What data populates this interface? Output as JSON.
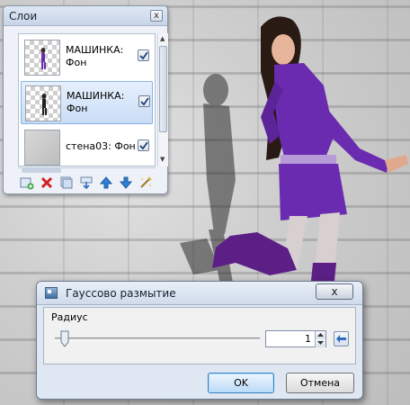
{
  "layers_panel": {
    "title": "Слои",
    "close_label": "x",
    "layers": [
      {
        "name_line1": "МАШИНКА:",
        "name_line2": "Фон",
        "visible": true,
        "selected": false
      },
      {
        "name_line1": "МАШИНКА:",
        "name_line2": "Фон",
        "visible": true,
        "selected": true
      },
      {
        "name_line1": "стена03: Фон",
        "name_line2": "",
        "visible": true,
        "selected": false
      }
    ],
    "toolbar_icons": [
      "add-layer-icon",
      "delete-layer-icon",
      "duplicate-layer-icon",
      "merge-down-icon",
      "move-up-icon",
      "move-down-icon",
      "properties-icon"
    ]
  },
  "blur_dialog": {
    "title": "Гауссово размытие",
    "close_label": "x",
    "radius_label": "Радиус",
    "radius_value": "1",
    "ok_label": "OK",
    "cancel_label": "Отмена"
  },
  "colors": {
    "purple_dress": "#6a2bb0",
    "accent_blue": "#3b7bbf"
  }
}
